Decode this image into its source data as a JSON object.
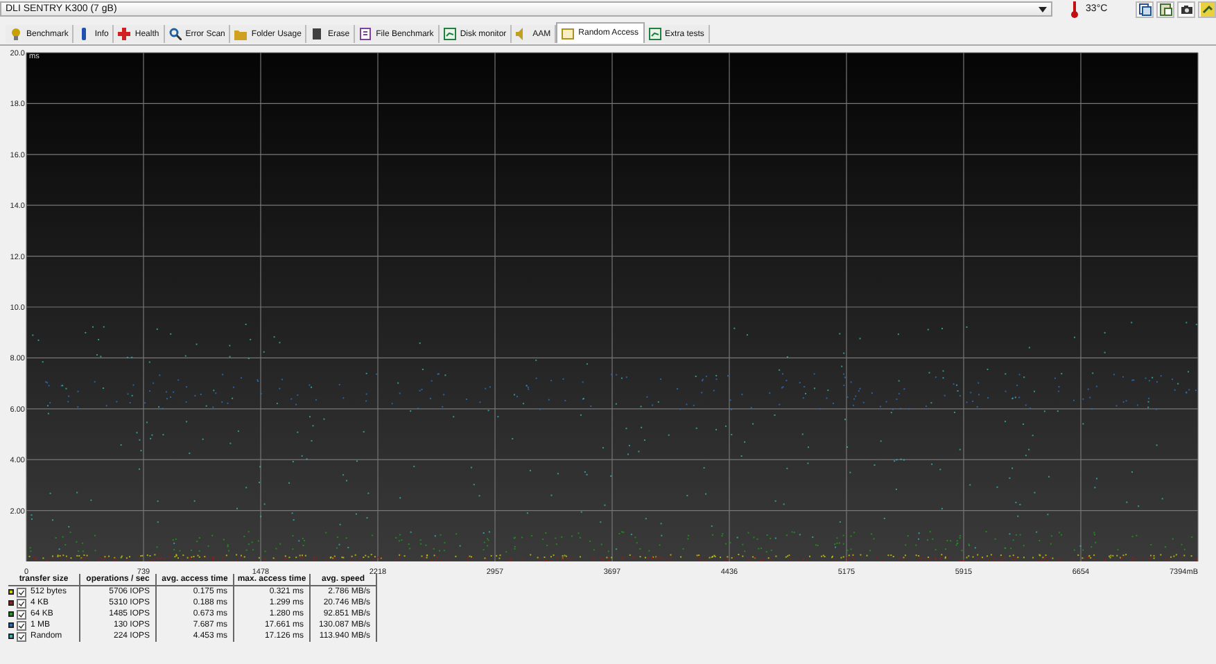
{
  "drive": {
    "value": "DLI    SENTRY K300 (7 gB)"
  },
  "temperature": "33°C",
  "tabs": [
    {
      "label": "Benchmark",
      "selected": false
    },
    {
      "label": "Info",
      "selected": false
    },
    {
      "label": "Health",
      "selected": false
    },
    {
      "label": "Error Scan",
      "selected": false
    },
    {
      "label": "Folder Usage",
      "selected": false
    },
    {
      "label": "Erase",
      "selected": false
    },
    {
      "label": "File Benchmark",
      "selected": false
    },
    {
      "label": "Disk monitor",
      "selected": false
    },
    {
      "label": "AAM",
      "selected": false
    },
    {
      "label": "Random Access",
      "selected": true
    },
    {
      "label": "Extra tests",
      "selected": false
    }
  ],
  "plot": {
    "unit": "ms",
    "y_labels": [
      "20.0",
      "18.0",
      "16.0",
      "14.0",
      "12.0",
      "10.0",
      "8.00",
      "6.00",
      "4.00",
      "2.00"
    ],
    "x_labels": [
      "0",
      "739",
      "1478",
      "2218",
      "2957",
      "3697",
      "4436",
      "5175",
      "5915",
      "6654",
      "7394mB"
    ]
  },
  "table": {
    "columns": [
      "transfer size",
      "operations / sec",
      "avg. access time",
      "max. access time",
      "avg. speed"
    ],
    "rows": [
      {
        "color": "#d0d000",
        "checked": true,
        "cells": [
          "512 bytes",
          "5706 IOPS",
          "0.175 ms",
          "0.321 ms",
          "2.786 MB/s"
        ]
      },
      {
        "color": "#a01818",
        "checked": true,
        "cells": [
          "4 KB",
          "5310 IOPS",
          "0.188 ms",
          "1.299 ms",
          "20.746 MB/s"
        ]
      },
      {
        "color": "#18a018",
        "checked": true,
        "cells": [
          "64 KB",
          "1485 IOPS",
          "0.673 ms",
          "1.280 ms",
          "92.851 MB/s"
        ]
      },
      {
        "color": "#2a70c8",
        "checked": true,
        "cells": [
          "1 MB",
          "130 IOPS",
          "7.687 ms",
          "17.661 ms",
          "130.087 MB/s"
        ]
      },
      {
        "color": "#30b8b8",
        "checked": true,
        "cells": [
          "Random",
          "224 IOPS",
          "4.453 ms",
          "17.126 ms",
          "113.940 MB/s"
        ]
      }
    ]
  }
}
